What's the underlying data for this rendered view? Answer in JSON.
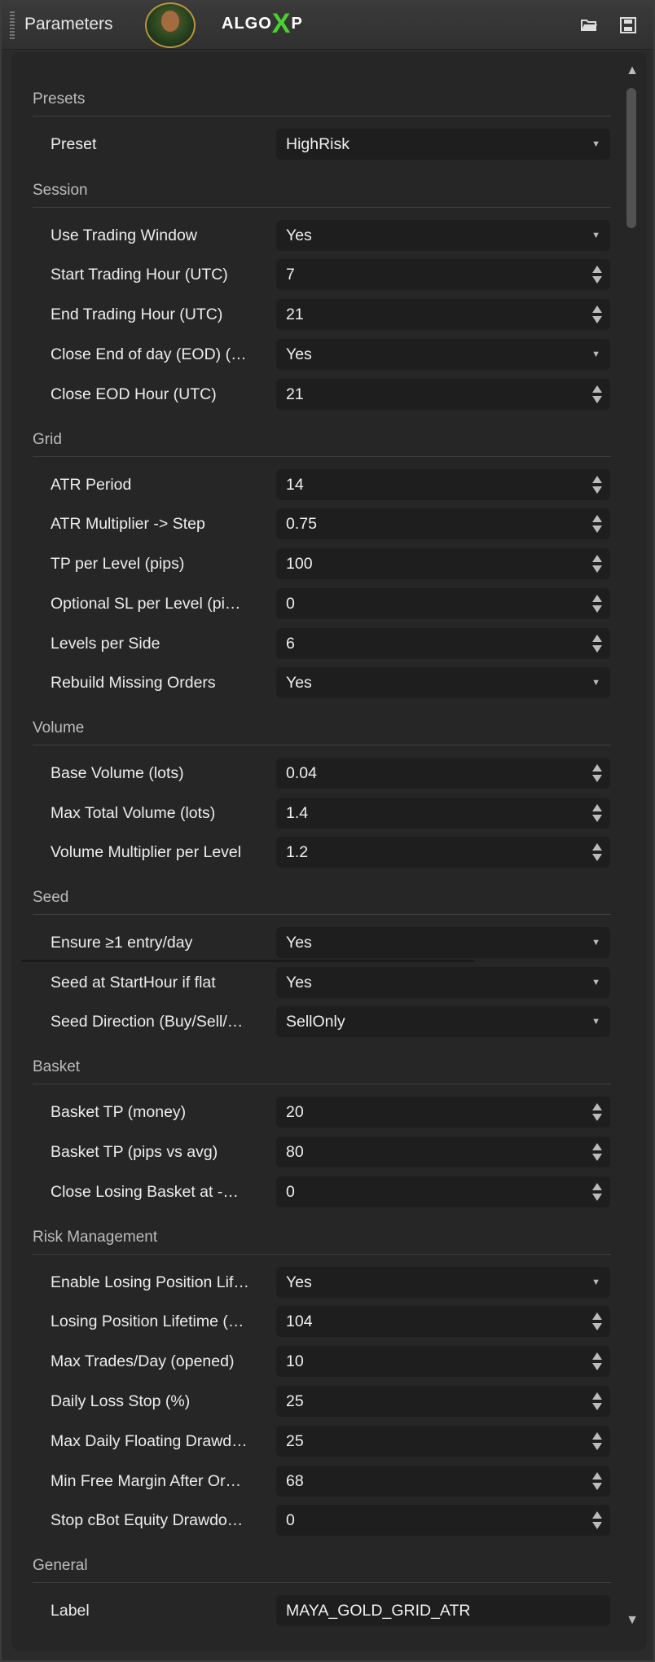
{
  "header": {
    "title": "Parameters",
    "brand_left": "ALGO",
    "brand_x": "X",
    "brand_right": "P",
    "icons": [
      "folder-open-icon",
      "save-icon"
    ]
  },
  "sections": {
    "presets": "Presets",
    "session": "Session",
    "grid": "Grid",
    "volume": "Volume",
    "seed": "Seed",
    "basket": "Basket",
    "risk": "Risk Management",
    "general": "General"
  },
  "rows": {
    "preset": {
      "label": "Preset",
      "value": "HighRisk"
    },
    "use_trading_window": {
      "label": "Use Trading Window",
      "value": "Yes"
    },
    "start_trading_hour": {
      "label": "Start Trading Hour (UTC)",
      "value": "7"
    },
    "end_trading_hour": {
      "label": "End Trading Hour (UTC)",
      "value": "21"
    },
    "close_eod": {
      "label": "Close End of day (EOD) (…",
      "value": "Yes"
    },
    "close_eod_hour": {
      "label": "Close EOD Hour (UTC)",
      "value": "21"
    },
    "atr_period": {
      "label": "ATR Period",
      "value": "14"
    },
    "atr_multiplier": {
      "label": "ATR Multiplier -> Step",
      "value": "0.75"
    },
    "tp_per_level": {
      "label": "TP per Level (pips)",
      "value": "100"
    },
    "optional_sl": {
      "label": "Optional SL per Level (pi…",
      "value": "0"
    },
    "levels_per_side": {
      "label": "Levels per Side",
      "value": "6"
    },
    "rebuild_missing": {
      "label": "Rebuild Missing Orders",
      "value": "Yes"
    },
    "base_volume": {
      "label": "Base Volume (lots)",
      "value": "0.04"
    },
    "max_total_volume": {
      "label": "Max Total Volume (lots)",
      "value": "1.4"
    },
    "volume_multiplier": {
      "label": "Volume Multiplier per Level",
      "value": "1.2"
    },
    "ensure_entry": {
      "label": "Ensure ≥1 entry/day",
      "value": "Yes"
    },
    "seed_at_start": {
      "label": "Seed at StartHour if flat",
      "value": "Yes"
    },
    "seed_direction": {
      "label": "Seed Direction (Buy/Sell/…",
      "value": "SellOnly"
    },
    "basket_tp_money": {
      "label": "Basket TP (money)",
      "value": "20"
    },
    "basket_tp_pips": {
      "label": "Basket TP (pips vs avg)",
      "value": "80"
    },
    "close_losing_basket": {
      "label": "Close Losing Basket at -…",
      "value": "0"
    },
    "enable_losing_lifetime": {
      "label": "Enable Losing Position Lif…",
      "value": "Yes"
    },
    "losing_lifetime": {
      "label": "Losing Position Lifetime (…",
      "value": "104"
    },
    "max_trades_day": {
      "label": "Max Trades/Day (opened)",
      "value": "10"
    },
    "daily_loss_stop": {
      "label": "Daily Loss Stop (%)",
      "value": "25"
    },
    "max_daily_floating": {
      "label": "Max Daily Floating Drawd…",
      "value": "25"
    },
    "min_free_margin": {
      "label": "Min Free Margin After Or…",
      "value": "68"
    },
    "stop_cbot_equity": {
      "label": "Stop cBot Equity Drawdo…",
      "value": "0"
    },
    "label": {
      "label": "Label",
      "value": "MAYA_GOLD_GRID_ATR"
    }
  }
}
